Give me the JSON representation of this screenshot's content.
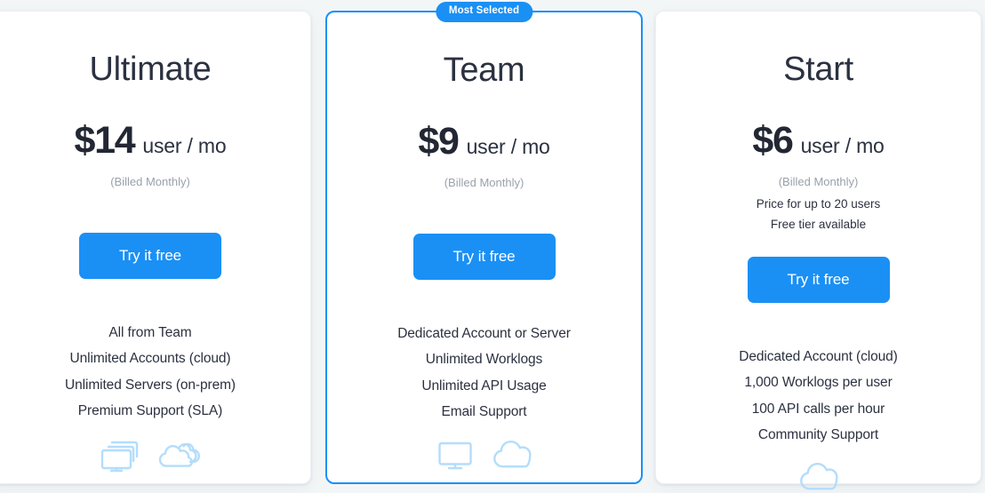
{
  "page": {
    "background_color": "#f3f6f7",
    "accent_color": "#1a90f5",
    "text_color": "#2b3140",
    "muted_text_color": "#9aa1ab",
    "icon_color": "#b3ddfb"
  },
  "plans": [
    {
      "id": "ultimate",
      "title": "Ultimate",
      "price_amount": "$14",
      "price_unit": "user / mo",
      "billed_note": "(Billed Monthly)",
      "extra_notes": [],
      "cta_label": "Try it free",
      "features": [
        "All from Team",
        "Unlimited Accounts (cloud)",
        "Unlimited Servers (on-prem)",
        "Premium Support (SLA)"
      ],
      "icons": [
        "multiple-monitors-icon",
        "multiple-clouds-icon"
      ],
      "featured": false,
      "badge": ""
    },
    {
      "id": "team",
      "title": "Team",
      "price_amount": "$9",
      "price_unit": "user / mo",
      "billed_note": "(Billed Monthly)",
      "extra_notes": [],
      "cta_label": "Try it free",
      "features": [
        "Dedicated Account or Server",
        "Unlimited Worklogs",
        "Unlimited API Usage",
        "Email Support"
      ],
      "icons": [
        "monitor-icon",
        "cloud-icon"
      ],
      "featured": true,
      "badge": "Most Selected"
    },
    {
      "id": "start",
      "title": "Start",
      "price_amount": "$6",
      "price_unit": "user / mo",
      "billed_note": "(Billed Monthly)",
      "extra_notes": [
        "Price for up to 20 users",
        "Free tier available"
      ],
      "cta_label": "Try it free",
      "features": [
        "Dedicated Account (cloud)",
        "1,000 Worklogs per user",
        "100 API calls per hour",
        "Community Support"
      ],
      "icons": [
        "cloud-icon"
      ],
      "featured": false,
      "badge": ""
    }
  ]
}
